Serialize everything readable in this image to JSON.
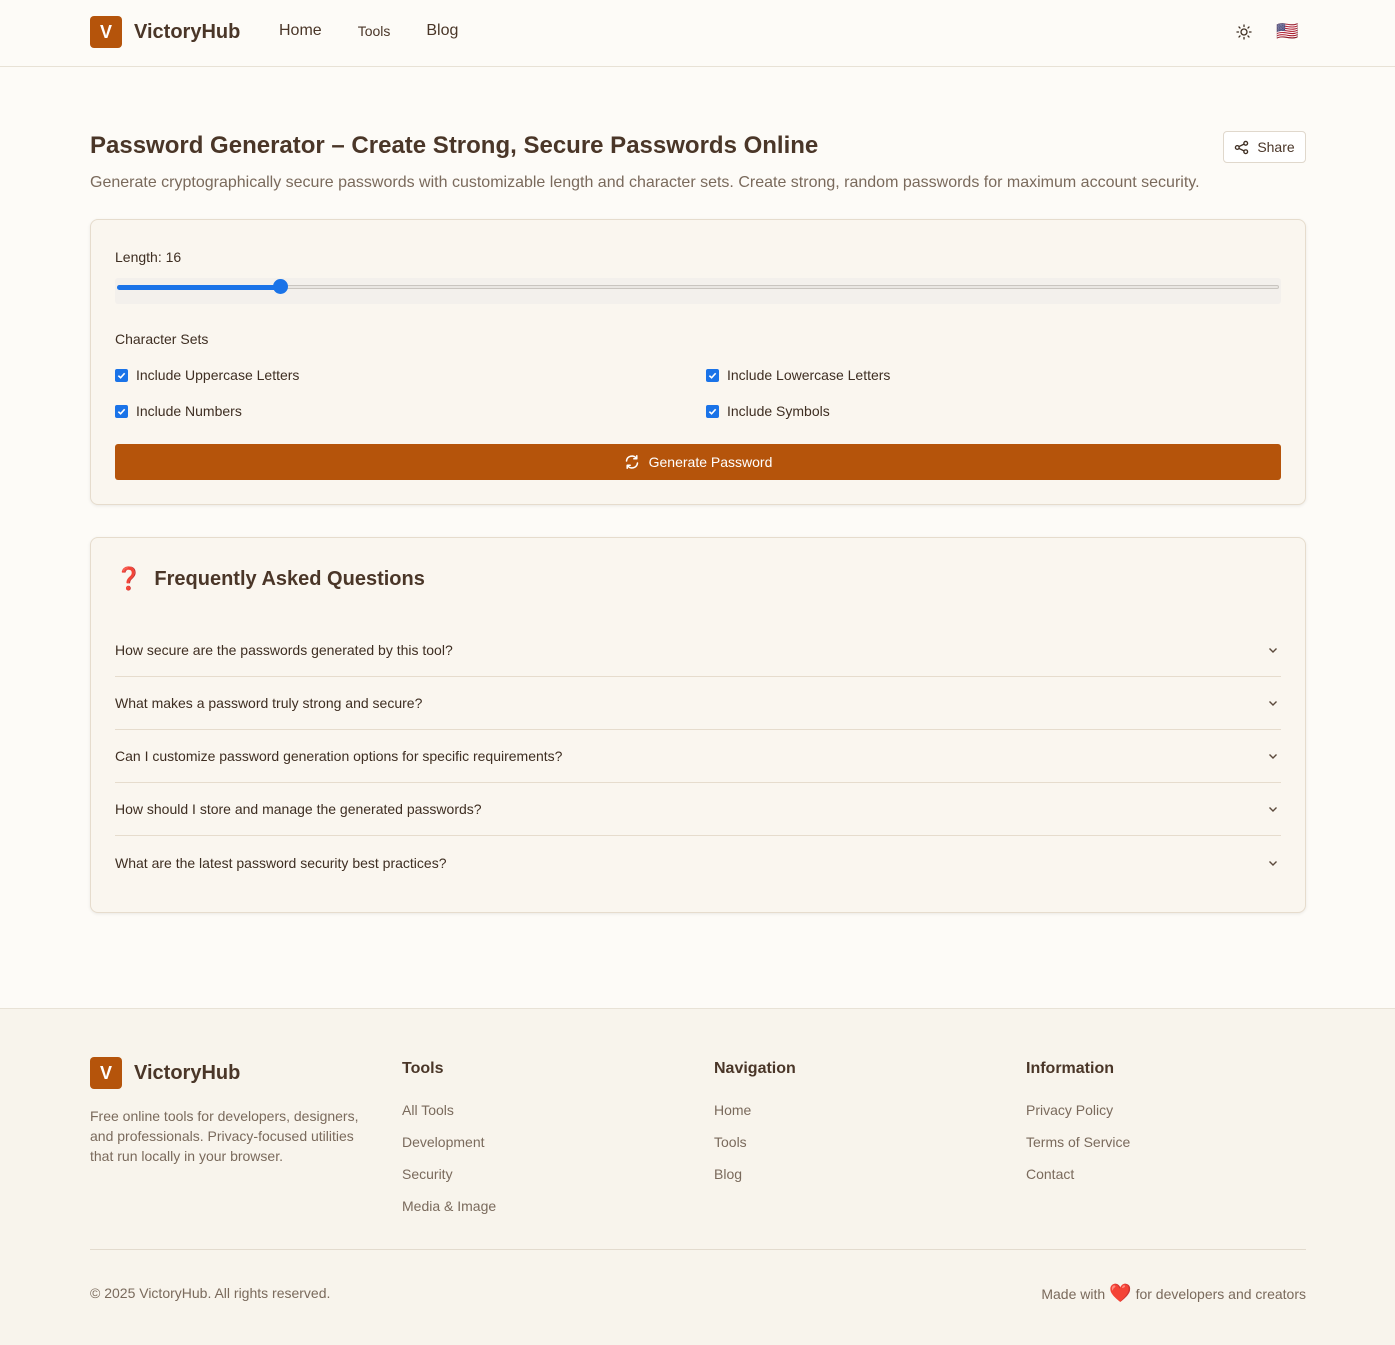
{
  "header": {
    "logo_letter": "V",
    "brand": "VictoryHub",
    "nav": {
      "home": "Home",
      "tools": "Tools",
      "blog": "Blog"
    },
    "flag": "🇺🇸"
  },
  "page": {
    "title": "Password Generator – Create Strong, Secure Passwords Online",
    "subtitle": "Generate cryptographically secure passwords with customizable length and character sets. Create strong, random passwords for maximum account security.",
    "share_label": "Share"
  },
  "generator": {
    "length_label": "Length: 16",
    "length_value": 16,
    "length_fraction": 0.14,
    "charsets_label": "Character Sets",
    "options": {
      "uppercase": "Include Uppercase Letters",
      "lowercase": "Include Lowercase Letters",
      "numbers": "Include Numbers",
      "symbols": "Include Symbols"
    },
    "generate_label": "Generate Password",
    "accent_color": "#b5540b",
    "control_color": "#1a73e8"
  },
  "faq": {
    "icon": "❓",
    "title": "Frequently Asked Questions",
    "items": [
      "How secure are the passwords generated by this tool?",
      "What makes a password truly strong and secure?",
      "Can I customize password generation options for specific requirements?",
      "How should I store and manage the generated passwords?",
      "What are the latest password security best practices?"
    ]
  },
  "footer": {
    "logo_letter": "V",
    "brand": "VictoryHub",
    "description": "Free online tools for developers, designers, and professionals. Privacy-focused utilities that run locally in your browser.",
    "tools": {
      "heading": "Tools",
      "links": [
        "All Tools",
        "Development",
        "Security",
        "Media & Image"
      ]
    },
    "navigation": {
      "heading": "Navigation",
      "links": [
        "Home",
        "Tools",
        "Blog"
      ]
    },
    "information": {
      "heading": "Information",
      "links": [
        "Privacy Policy",
        "Terms of Service",
        "Contact"
      ]
    },
    "copyright": "© 2025 VictoryHub. All rights reserved.",
    "made_with_prefix": "Made with",
    "heart": "❤️",
    "made_with_suffix": "for developers and creators"
  }
}
